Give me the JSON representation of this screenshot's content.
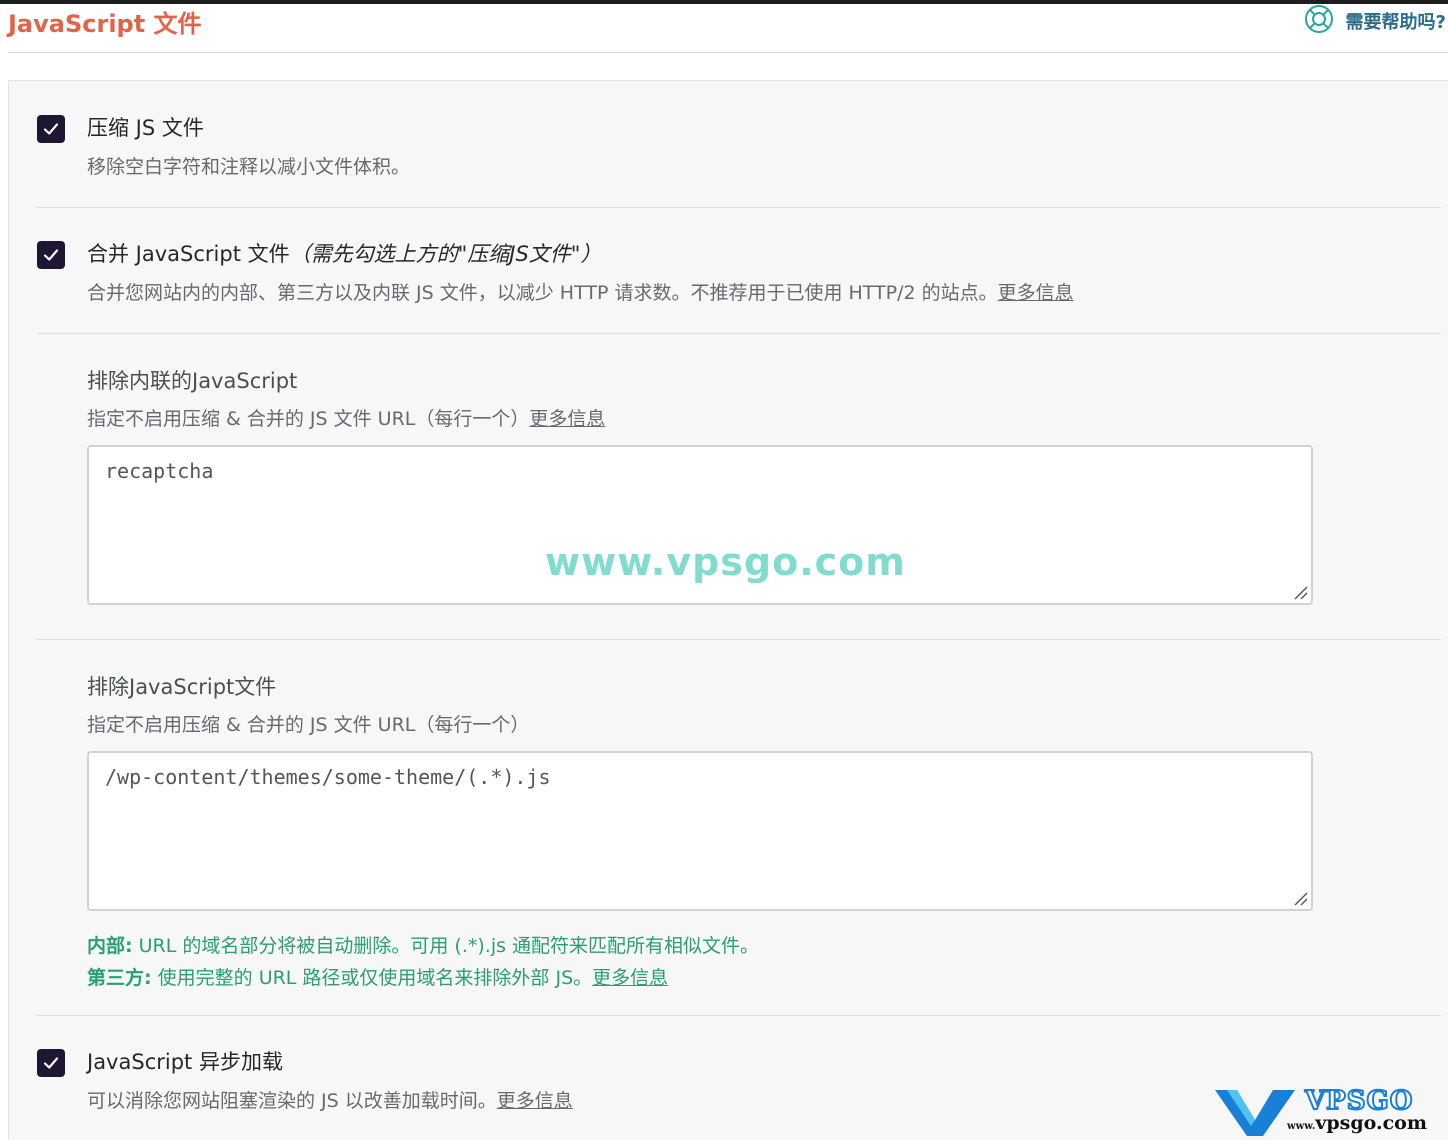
{
  "header": {
    "title": "JavaScript 文件",
    "help_label": "需要帮助吗?",
    "help_icon": "lifebuoy-icon"
  },
  "options": {
    "minify": {
      "checked": true,
      "title": "压缩 JS 文件",
      "desc": "移除空白字符和注释以减小文件体积。"
    },
    "combine": {
      "checked": true,
      "title": "合并 JavaScript 文件",
      "title_note": "（需先勾选上方的\"压缩JS文件\"）",
      "desc": "合并您网站内的内部、第三方以及内联 JS 文件，以减少 HTTP 请求数。不推荐用于已使用 HTTP/2 的站点。",
      "link": "更多信息"
    },
    "defer": {
      "checked": true,
      "title": "JavaScript 异步加载",
      "desc": "可以消除您网站阻塞渲染的 JS 以改善加载时间。",
      "link": "更多信息"
    }
  },
  "exclude_inline": {
    "title": "排除内联的JavaScript",
    "desc": "指定不启用压缩 & 合并的 JS 文件 URL（每行一个）",
    "link": "更多信息",
    "value": "recaptcha"
  },
  "exclude_files": {
    "title": "排除JavaScript文件",
    "desc": "指定不启用压缩 & 合并的 JS 文件 URL（每行一个）",
    "value": "/wp-content/themes/some-theme/(.*).js",
    "note_internal_label": "内部:",
    "note_internal_text": " URL 的域名部分将被自动删除。可用 (.*).js 通配符来匹配所有相似文件。",
    "note_third_label": "第三方:",
    "note_third_text": " 使用完整的 URL 路径或仅使用域名来排除外部 JS。",
    "note_link": "更多信息"
  },
  "watermark": "www.vpsgo.com",
  "logo": {
    "line1": "VPSGO",
    "line2": "vpsgo.com",
    "prefix": "www."
  },
  "colors": {
    "title": "#e2624a",
    "help": "#2b6c8a",
    "checkbox": "#1f1633",
    "note": "#2aa06e",
    "watermark": "#7fdccf"
  }
}
